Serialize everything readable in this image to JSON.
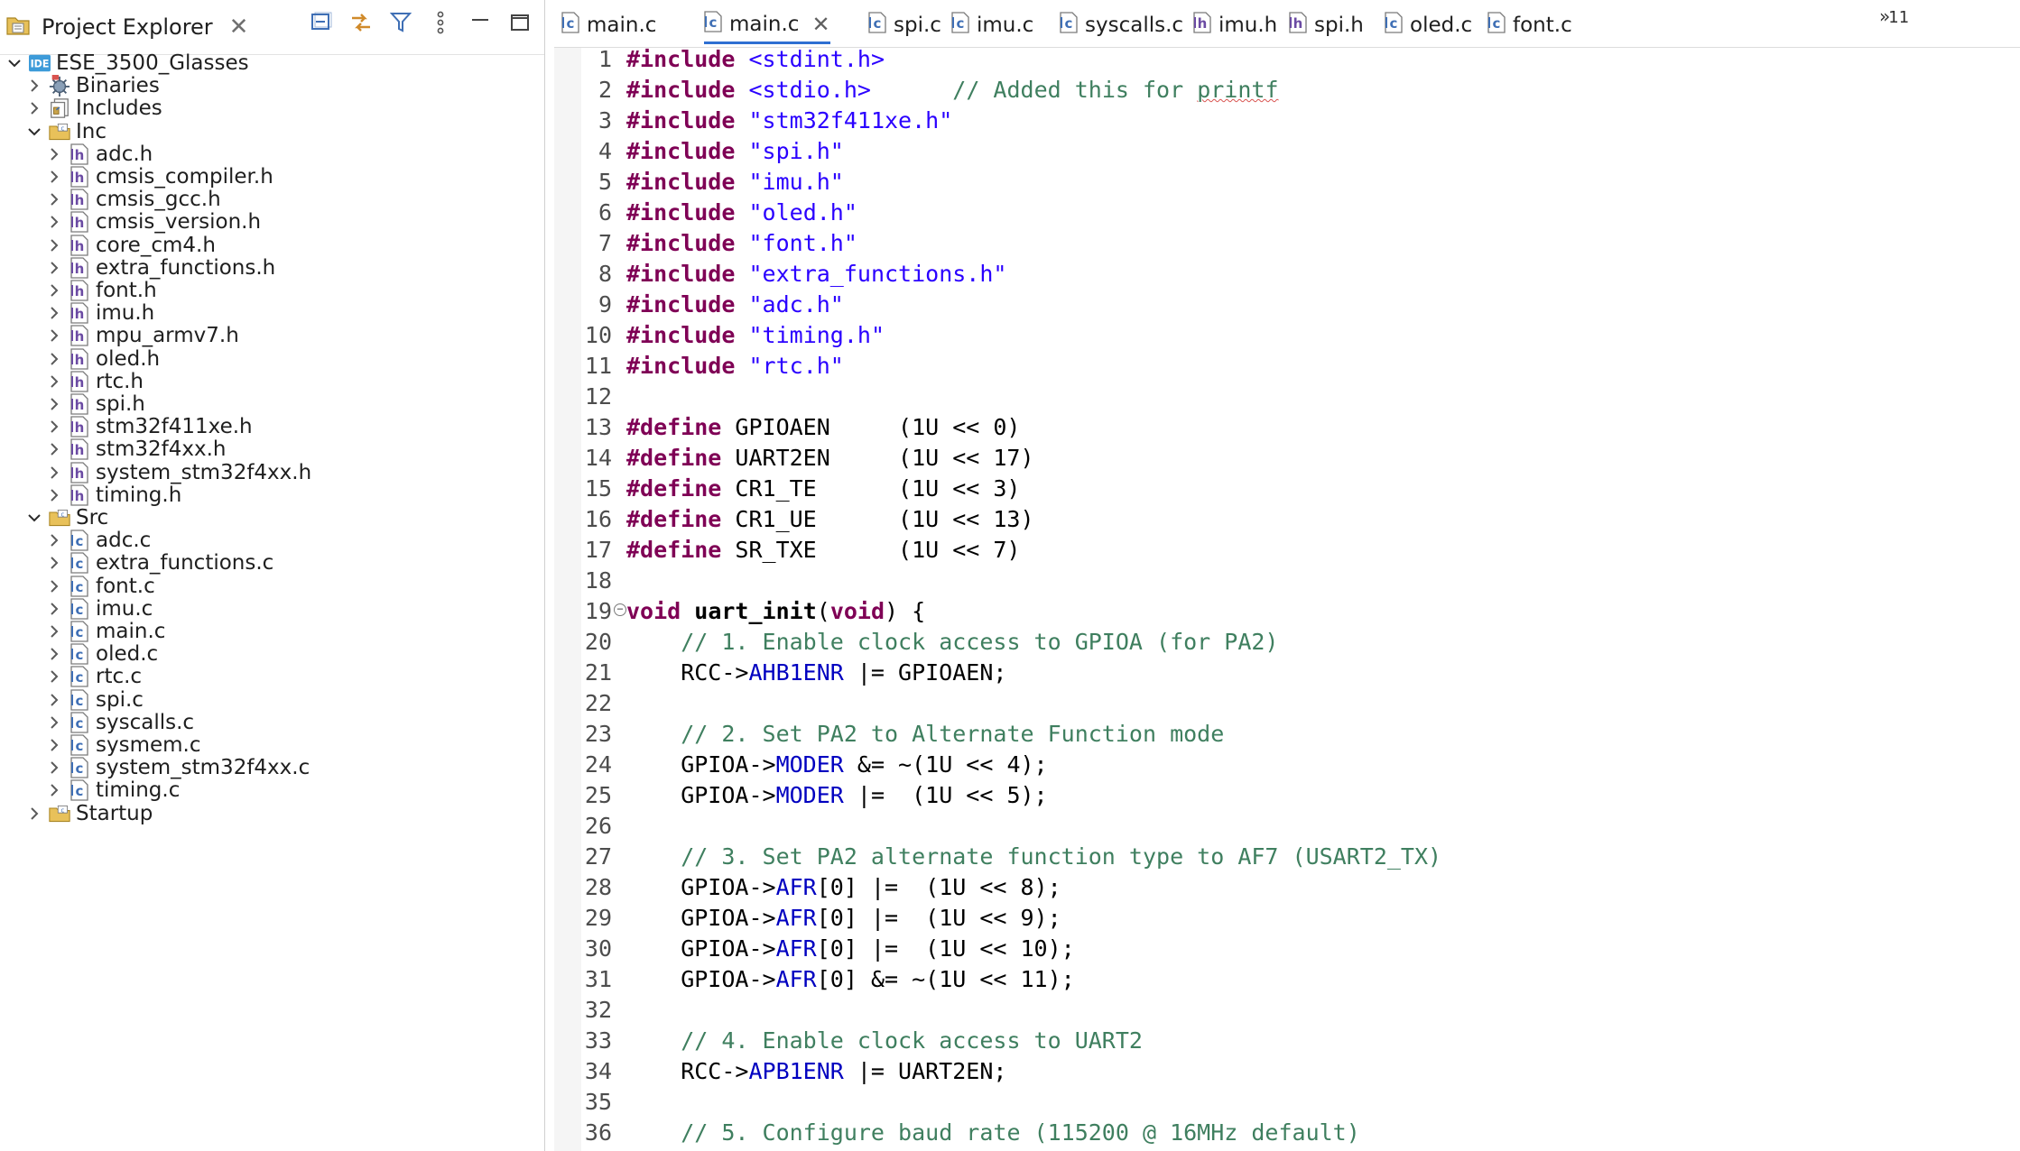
{
  "explorer": {
    "title": "Project Explorer",
    "tools": [
      "collapse-all-icon",
      "link-with-editor-icon",
      "filter-icon",
      "view-menu-icon",
      "minimize-icon",
      "maximize-icon"
    ],
    "tree": [
      {
        "label": "ESE_3500_Glasses",
        "depth": 0,
        "expanded": true,
        "icon": "ide-project-icon"
      },
      {
        "label": "Binaries",
        "depth": 1,
        "expanded": false,
        "icon": "binaries-icon"
      },
      {
        "label": "Includes",
        "depth": 1,
        "expanded": false,
        "icon": "includes-icon"
      },
      {
        "label": "Inc",
        "depth": 1,
        "expanded": true,
        "icon": "source-folder-icon"
      },
      {
        "label": "adc.h",
        "depth": 2,
        "expanded": false,
        "icon": "header-file-icon"
      },
      {
        "label": "cmsis_compiler.h",
        "depth": 2,
        "expanded": false,
        "icon": "header-file-icon"
      },
      {
        "label": "cmsis_gcc.h",
        "depth": 2,
        "expanded": false,
        "icon": "header-file-icon"
      },
      {
        "label": "cmsis_version.h",
        "depth": 2,
        "expanded": false,
        "icon": "header-file-icon"
      },
      {
        "label": "core_cm4.h",
        "depth": 2,
        "expanded": false,
        "icon": "header-file-icon"
      },
      {
        "label": "extra_functions.h",
        "depth": 2,
        "expanded": false,
        "icon": "header-file-icon"
      },
      {
        "label": "font.h",
        "depth": 2,
        "expanded": false,
        "icon": "header-file-icon"
      },
      {
        "label": "imu.h",
        "depth": 2,
        "expanded": false,
        "icon": "header-file-icon"
      },
      {
        "label": "mpu_armv7.h",
        "depth": 2,
        "expanded": false,
        "icon": "header-file-icon"
      },
      {
        "label": "oled.h",
        "depth": 2,
        "expanded": false,
        "icon": "header-file-icon"
      },
      {
        "label": "rtc.h",
        "depth": 2,
        "expanded": false,
        "icon": "header-file-icon"
      },
      {
        "label": "spi.h",
        "depth": 2,
        "expanded": false,
        "icon": "header-file-icon"
      },
      {
        "label": "stm32f411xe.h",
        "depth": 2,
        "expanded": false,
        "icon": "header-file-icon"
      },
      {
        "label": "stm32f4xx.h",
        "depth": 2,
        "expanded": false,
        "icon": "header-file-icon"
      },
      {
        "label": "system_stm32f4xx.h",
        "depth": 2,
        "expanded": false,
        "icon": "header-file-icon"
      },
      {
        "label": "timing.h",
        "depth": 2,
        "expanded": false,
        "icon": "header-file-icon"
      },
      {
        "label": "Src",
        "depth": 1,
        "expanded": true,
        "icon": "source-folder-icon"
      },
      {
        "label": "adc.c",
        "depth": 2,
        "expanded": false,
        "icon": "c-file-icon"
      },
      {
        "label": "extra_functions.c",
        "depth": 2,
        "expanded": false,
        "icon": "c-file-icon"
      },
      {
        "label": "font.c",
        "depth": 2,
        "expanded": false,
        "icon": "c-file-icon"
      },
      {
        "label": "imu.c",
        "depth": 2,
        "expanded": false,
        "icon": "c-file-icon"
      },
      {
        "label": "main.c",
        "depth": 2,
        "expanded": false,
        "icon": "c-file-icon"
      },
      {
        "label": "oled.c",
        "depth": 2,
        "expanded": false,
        "icon": "c-file-icon"
      },
      {
        "label": "rtc.c",
        "depth": 2,
        "expanded": false,
        "icon": "c-file-icon"
      },
      {
        "label": "spi.c",
        "depth": 2,
        "expanded": false,
        "icon": "c-file-icon"
      },
      {
        "label": "syscalls.c",
        "depth": 2,
        "expanded": false,
        "icon": "c-file-icon"
      },
      {
        "label": "sysmem.c",
        "depth": 2,
        "expanded": false,
        "icon": "c-file-icon"
      },
      {
        "label": "system_stm32f4xx.c",
        "depth": 2,
        "expanded": false,
        "icon": "c-file-icon"
      },
      {
        "label": "timing.c",
        "depth": 2,
        "expanded": false,
        "icon": "c-file-icon"
      },
      {
        "label": "Startup",
        "depth": 1,
        "expanded": false,
        "icon": "source-folder-icon"
      }
    ]
  },
  "editor": {
    "tabs": [
      {
        "label": "main.c",
        "active": false,
        "closable": false
      },
      {
        "label": "main.c",
        "active": true,
        "closable": true
      },
      {
        "label": "spi.c",
        "active": false,
        "closable": false
      },
      {
        "label": "imu.c",
        "active": false,
        "closable": false
      },
      {
        "label": "syscalls.c",
        "active": false,
        "closable": false
      },
      {
        "label": "imu.h",
        "active": false,
        "closable": false
      },
      {
        "label": "spi.h",
        "active": false,
        "closable": false
      },
      {
        "label": "oled.c",
        "active": false,
        "closable": false
      },
      {
        "label": "font.c",
        "active": false,
        "closable": false
      }
    ],
    "overflow_arrows": "»",
    "overflow_count": "11",
    "lines": [
      {
        "n": "1",
        "fold": false,
        "tokens": [
          [
            "kw",
            "#include"
          ],
          [
            "t",
            " "
          ],
          [
            "str",
            "<stdint.h>"
          ]
        ]
      },
      {
        "n": "2",
        "fold": false,
        "tokens": [
          [
            "kw",
            "#include"
          ],
          [
            "t",
            " "
          ],
          [
            "str",
            "<stdio.h>"
          ],
          [
            "t",
            "      "
          ],
          [
            "com",
            "// Added this for "
          ],
          [
            "comsq",
            "printf"
          ]
        ]
      },
      {
        "n": "3",
        "fold": false,
        "tokens": [
          [
            "kw",
            "#include"
          ],
          [
            "t",
            " "
          ],
          [
            "str",
            "\"stm32f411xe.h\""
          ]
        ]
      },
      {
        "n": "4",
        "fold": false,
        "tokens": [
          [
            "kw",
            "#include"
          ],
          [
            "t",
            " "
          ],
          [
            "str",
            "\"spi.h\""
          ]
        ]
      },
      {
        "n": "5",
        "fold": false,
        "tokens": [
          [
            "kw",
            "#include"
          ],
          [
            "t",
            " "
          ],
          [
            "str",
            "\"imu.h\""
          ]
        ]
      },
      {
        "n": "6",
        "fold": false,
        "tokens": [
          [
            "kw",
            "#include"
          ],
          [
            "t",
            " "
          ],
          [
            "str",
            "\"oled.h\""
          ]
        ]
      },
      {
        "n": "7",
        "fold": false,
        "tokens": [
          [
            "kw",
            "#include"
          ],
          [
            "t",
            " "
          ],
          [
            "str",
            "\"font.h\""
          ]
        ]
      },
      {
        "n": "8",
        "fold": false,
        "tokens": [
          [
            "kw",
            "#include"
          ],
          [
            "t",
            " "
          ],
          [
            "str",
            "\"extra_functions.h\""
          ]
        ]
      },
      {
        "n": "9",
        "fold": false,
        "tokens": [
          [
            "kw",
            "#include"
          ],
          [
            "t",
            " "
          ],
          [
            "str",
            "\"adc.h\""
          ]
        ]
      },
      {
        "n": "10",
        "fold": false,
        "tokens": [
          [
            "kw",
            "#include"
          ],
          [
            "t",
            " "
          ],
          [
            "str",
            "\"timing.h\""
          ]
        ]
      },
      {
        "n": "11",
        "fold": false,
        "tokens": [
          [
            "kw",
            "#include"
          ],
          [
            "t",
            " "
          ],
          [
            "str",
            "\"rtc.h\""
          ]
        ]
      },
      {
        "n": "12",
        "fold": false,
        "tokens": []
      },
      {
        "n": "13",
        "fold": false,
        "tokens": [
          [
            "kw",
            "#define"
          ],
          [
            "t",
            " GPIOAEN     (1U << 0)"
          ]
        ]
      },
      {
        "n": "14",
        "fold": false,
        "tokens": [
          [
            "kw",
            "#define"
          ],
          [
            "t",
            " UART2EN     (1U << 17)"
          ]
        ]
      },
      {
        "n": "15",
        "fold": false,
        "tokens": [
          [
            "kw",
            "#define"
          ],
          [
            "t",
            " CR1_TE      (1U << 3)"
          ]
        ]
      },
      {
        "n": "16",
        "fold": false,
        "tokens": [
          [
            "kw",
            "#define"
          ],
          [
            "t",
            " CR1_UE      (1U << 13)"
          ]
        ]
      },
      {
        "n": "17",
        "fold": false,
        "tokens": [
          [
            "kw",
            "#define"
          ],
          [
            "t",
            " SR_TXE      (1U << 7)"
          ]
        ]
      },
      {
        "n": "18",
        "fold": false,
        "tokens": []
      },
      {
        "n": "19",
        "fold": true,
        "tokens": [
          [
            "kw",
            "void"
          ],
          [
            "t",
            " "
          ],
          [
            "fn",
            "uart_init"
          ],
          [
            "t",
            "("
          ],
          [
            "kw",
            "void"
          ],
          [
            "t",
            ") {"
          ]
        ]
      },
      {
        "n": "20",
        "fold": false,
        "tokens": [
          [
            "t",
            "    "
          ],
          [
            "com",
            "// 1. Enable clock access to GPIOA (for PA2)"
          ]
        ]
      },
      {
        "n": "21",
        "fold": false,
        "tokens": [
          [
            "t",
            "    RCC->"
          ],
          [
            "fld",
            "AHB1ENR"
          ],
          [
            "t",
            " |= GPIOAEN;"
          ]
        ]
      },
      {
        "n": "22",
        "fold": false,
        "tokens": []
      },
      {
        "n": "23",
        "fold": false,
        "tokens": [
          [
            "t",
            "    "
          ],
          [
            "com",
            "// 2. Set PA2 to Alternate Function mode"
          ]
        ]
      },
      {
        "n": "24",
        "fold": false,
        "tokens": [
          [
            "t",
            "    GPIOA->"
          ],
          [
            "fld",
            "MODER"
          ],
          [
            "t",
            " &= ~(1U << 4);"
          ]
        ]
      },
      {
        "n": "25",
        "fold": false,
        "tokens": [
          [
            "t",
            "    GPIOA->"
          ],
          [
            "fld",
            "MODER"
          ],
          [
            "t",
            " |=  (1U << 5);"
          ]
        ]
      },
      {
        "n": "26",
        "fold": false,
        "tokens": []
      },
      {
        "n": "27",
        "fold": false,
        "tokens": [
          [
            "t",
            "    "
          ],
          [
            "com",
            "// 3. Set PA2 alternate function type to AF7 (USART2_TX)"
          ]
        ]
      },
      {
        "n": "28",
        "fold": false,
        "tokens": [
          [
            "t",
            "    GPIOA->"
          ],
          [
            "fld",
            "AFR"
          ],
          [
            "t",
            "[0] |=  (1U << 8);"
          ]
        ]
      },
      {
        "n": "29",
        "fold": false,
        "tokens": [
          [
            "t",
            "    GPIOA->"
          ],
          [
            "fld",
            "AFR"
          ],
          [
            "t",
            "[0] |=  (1U << 9);"
          ]
        ]
      },
      {
        "n": "30",
        "fold": false,
        "tokens": [
          [
            "t",
            "    GPIOA->"
          ],
          [
            "fld",
            "AFR"
          ],
          [
            "t",
            "[0] |=  (1U << 10);"
          ]
        ]
      },
      {
        "n": "31",
        "fold": false,
        "tokens": [
          [
            "t",
            "    GPIOA->"
          ],
          [
            "fld",
            "AFR"
          ],
          [
            "t",
            "[0] &= ~(1U << 11);"
          ]
        ]
      },
      {
        "n": "32",
        "fold": false,
        "tokens": []
      },
      {
        "n": "33",
        "fold": false,
        "tokens": [
          [
            "t",
            "    "
          ],
          [
            "com",
            "// 4. Enable clock access to UART2"
          ]
        ]
      },
      {
        "n": "34",
        "fold": false,
        "tokens": [
          [
            "t",
            "    RCC->"
          ],
          [
            "fld",
            "APB1ENR"
          ],
          [
            "t",
            " |= UART2EN;"
          ]
        ]
      },
      {
        "n": "35",
        "fold": false,
        "tokens": []
      },
      {
        "n": "36",
        "fold": false,
        "tokens": [
          [
            "t",
            "    "
          ],
          [
            "com",
            "// 5. Configure baud rate (115200 @ 16MHz default)"
          ]
        ]
      }
    ]
  },
  "colors": {
    "keyword": "#7f0055",
    "string": "#2a00ff",
    "comment": "#3f7f5f",
    "field": "#0000c0",
    "active_tab_underline": "#2e6fd2",
    "ide_badge": "#3d9bd9"
  }
}
